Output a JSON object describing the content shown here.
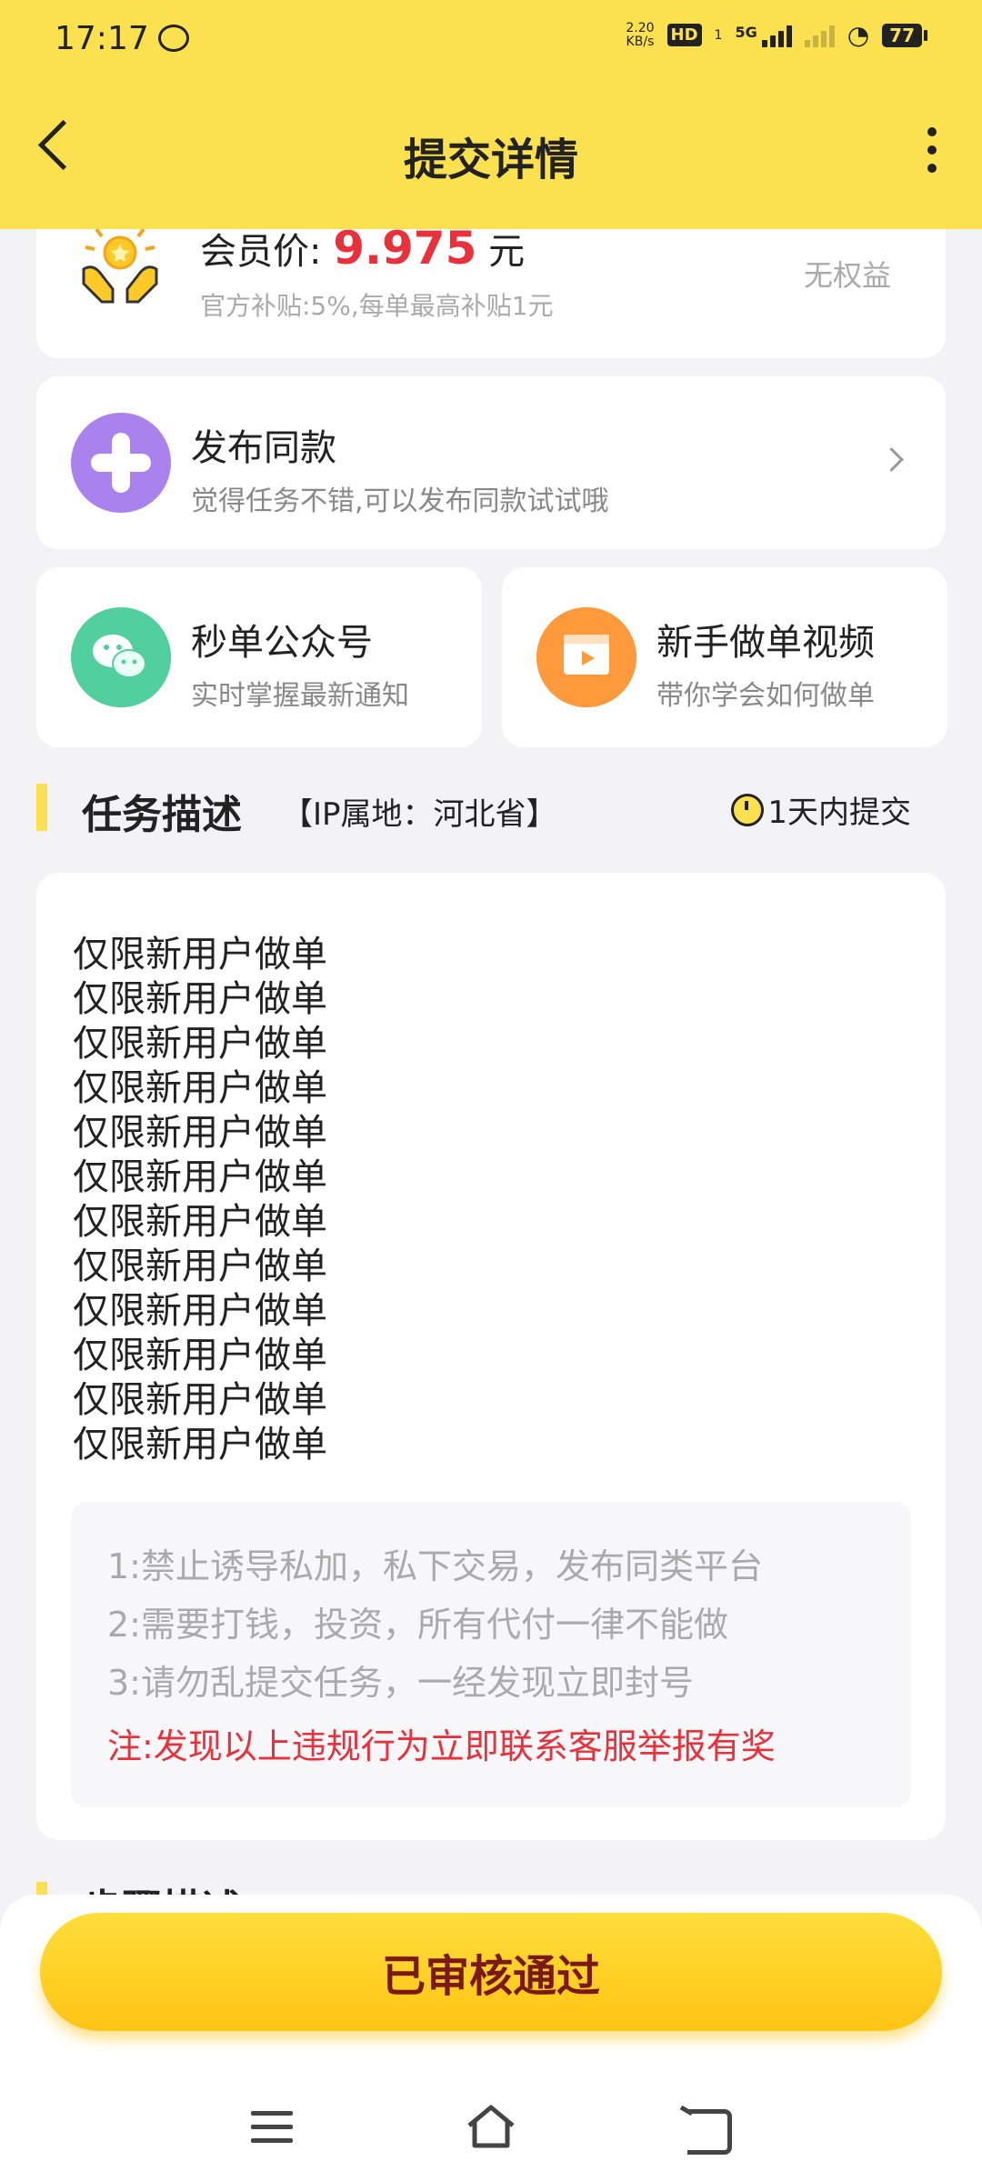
{
  "status_bar": {
    "time": "17:17",
    "speed_value": "2.20",
    "speed_unit": "KB/s",
    "hd_label": "HD",
    "sim_label": "1",
    "network_label": "5G",
    "battery": "77"
  },
  "header": {
    "title": "提交详情"
  },
  "member": {
    "label": "会员价:",
    "price": "9.975",
    "unit": "元",
    "subsidy": "官方补贴:5%,每单最高补贴1元",
    "rights": "无权益"
  },
  "publish_same": {
    "title": "发布同款",
    "subtitle": "觉得任务不错,可以发布同款试试哦"
  },
  "official_account": {
    "title": "秒单公众号",
    "subtitle": "实时掌握最新通知"
  },
  "tutorial_video": {
    "title": "新手做单视频",
    "subtitle": "带你学会如何做单"
  },
  "task_section": {
    "title": "任务描述",
    "ip_location": "【IP属地：河北省】",
    "deadline": "1天内提交"
  },
  "description": {
    "lines": [
      "仅限新用户做单",
      "仅限新用户做单",
      "仅限新用户做单",
      "仅限新用户做单",
      "仅限新用户做单",
      "仅限新用户做单",
      "仅限新用户做单",
      "仅限新用户做单",
      "仅限新用户做单",
      "仅限新用户做单",
      "仅限新用户做单",
      "仅限新用户做单"
    ],
    "rules": [
      "1:禁止诱导私加，私下交易，发布同类平台",
      "2:需要打钱，投资，所有代付一律不能做",
      "3:请勿乱提交任务，一经发现立即封号"
    ],
    "warning": "注:发现以上违规行为立即联系客服举报有奖"
  },
  "steps_section": {
    "title": "步骤描述"
  },
  "footer": {
    "button_label": "已审核通过"
  },
  "colors": {
    "accent": "#fbe04f",
    "price_red": "#e8313a",
    "button_text": "#7b1818"
  }
}
